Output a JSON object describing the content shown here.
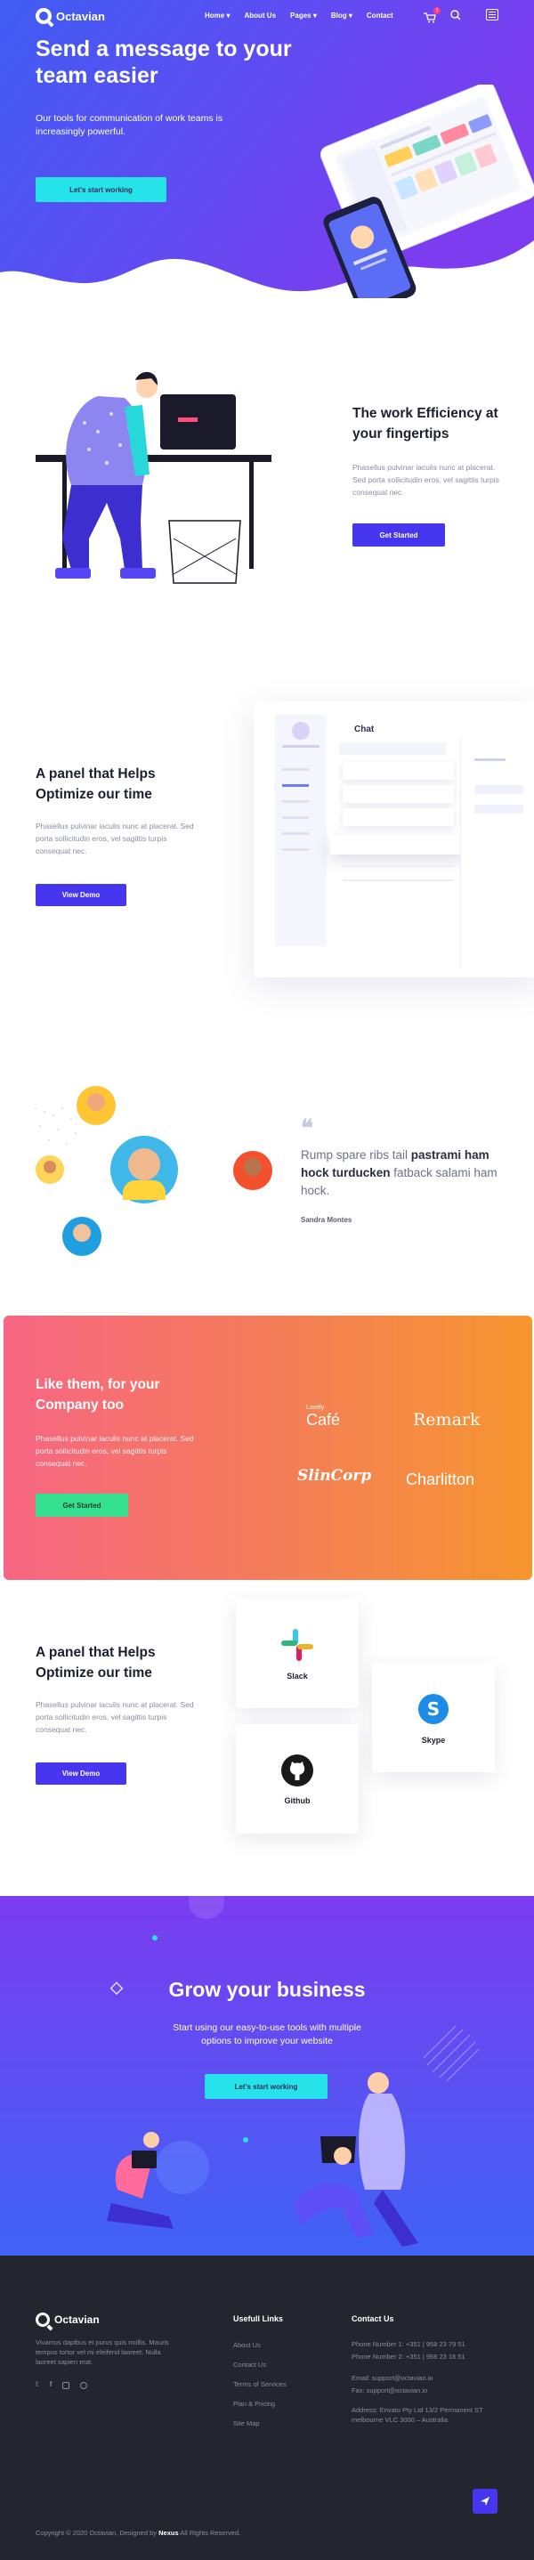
{
  "nav": {
    "brand": "Octavian",
    "menu": [
      "Home",
      "About Us",
      "Pages",
      "Blog",
      "Contact"
    ],
    "cart_count": "1"
  },
  "hero": {
    "title": "Send a message to your team easier",
    "subtitle": "Our tools for communication of work teams is increasingly powerful.",
    "button": "Let's start working"
  },
  "efficiency": {
    "title": "The work Efficiency at your fingertips",
    "text": "Phasellus pulvinar iaculis nunc at placerat. Sed porta sollicitudin eros, vel sagittis turpis consequat nec.",
    "button": "Get Started"
  },
  "panel1": {
    "title": "A panel that Helps Optimize our time",
    "text": "Phasellus pulvinar iaculis nunc at placerat. Sed porta sollicitudin eros, vel sagittis turpis consequat nec.",
    "button": "View Demo",
    "app_heading": "Chat"
  },
  "testimonial": {
    "quote_bold": "pastrami ham hock turducken",
    "quote_before": "Rump spare ribs tail ",
    "quote_after": " fatback salami ham hock.",
    "author": "Sandra Montes"
  },
  "clients": {
    "title": "Like them, for your Company too",
    "text": "Phasellus pulvinar iaculis nunc at placerat. Sed porta sollicitudin eros, vel sagittis turpis consequat nec.",
    "button": "Get Started",
    "logos": [
      "Lovely",
      "Café",
      "Remark",
      "SlinCorp",
      "Charlitton"
    ]
  },
  "panel2": {
    "title": "A panel that Helps Optimize our time",
    "text": "Phasellus pulvinar iaculis nunc at placerat. Sed porta sollicitudin eros, vel sagittis turpis consequat nec.",
    "button": "View Demo",
    "integrations": [
      "Slack",
      "Skype",
      "Github"
    ]
  },
  "grow": {
    "title": "Grow your business",
    "subtitle": "Start using our easy-to-use tools with multiple options to improve your website",
    "button": "Let's start working"
  },
  "footer": {
    "brand": "Octavian",
    "about": "Vivamus dapibus et purus quis mollis. Mauris tempus tortor vel mi eleifend laoreet. Nulla laoreet sapien erat.",
    "links_heading": "Usefull Links",
    "links": [
      "About Us",
      "Contact Us",
      "Terms of Services",
      "Plan & Pricing",
      "Site Map"
    ],
    "contact_heading": "Contact Us",
    "phone1": "Phone Number 1: +351 | 958 23 79 51",
    "phone2": "Phone Number 2: +351 | 958 23 16 51",
    "email": "Email: support@octavian.io",
    "fax": "Fax: support@octavian.io",
    "address": "Address: Envato Pty Ltd 13/2 Permanent ST melbourne VLC 3000 – Australia",
    "copyright_prefix": "Copyright © 2020 Octavian, Designed by ",
    "copyright_brand": "Nexus",
    "copyright_suffix": " All Rights Reserved."
  },
  "colors": {
    "primary": "#4636f0",
    "hero_from": "#3d5cf3",
    "hero_to": "#7a3cf0",
    "cyan": "#25e3e8",
    "orange_from": "#f76683",
    "orange_to": "#f7962f",
    "footer_bg": "#24262f"
  }
}
